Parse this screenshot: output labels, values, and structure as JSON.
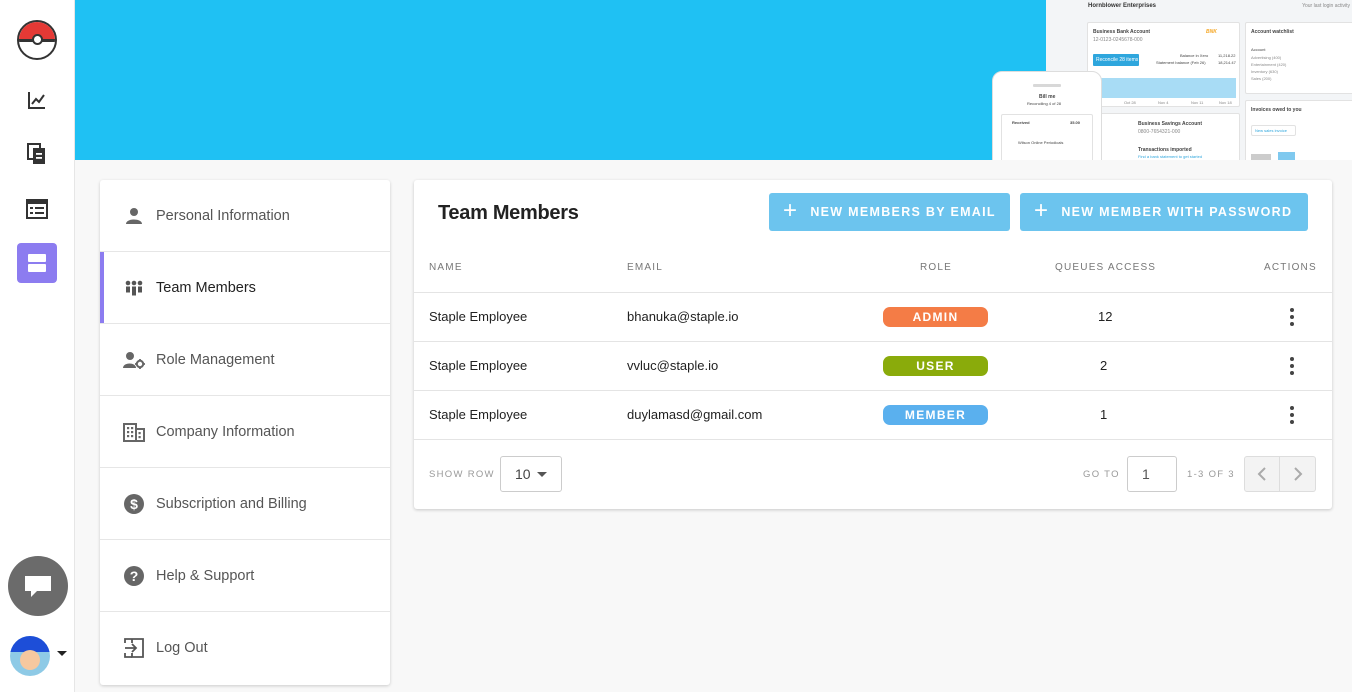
{
  "colors": {
    "accent": "#8c7cf0",
    "hero": "#1fc1f3",
    "button": "#6cc4ee",
    "role_admin": "#f47c46",
    "role_user": "#8aab0b",
    "role_member": "#5ab0ee"
  },
  "rail": {
    "items": [
      {
        "icon": "chart-line-icon"
      },
      {
        "icon": "documents-icon"
      },
      {
        "icon": "list-view-icon"
      },
      {
        "icon": "storage-icon",
        "active": true
      }
    ]
  },
  "hero_mock": {
    "company": "Hornblower Enterprises",
    "corner_text": "Your last login activity",
    "bank_account": "Business Bank Account",
    "bank_number": "12-0123-0245678-000",
    "bank_logo": "BNK",
    "reconcile": "Reconcile 28 items",
    "balance_label": "Balance in Xero",
    "balance_value": "11,218.22",
    "statement_label": "Statement balance (Feb 26)",
    "statement_value": "18,214.47",
    "dates": [
      "Oct 28",
      "Nov 4",
      "Nov 11",
      "Nov 18"
    ],
    "watchlist": "Account watchlist",
    "watch_header": "Account",
    "watch_items": [
      "Advertising (400)",
      "Entertainment (420)",
      "Inventory (630)",
      "Sales (200)"
    ],
    "savings": "Business Savings Account",
    "savings_number": "0800-7654321-000",
    "transactions": "Transactions imported",
    "transactions_sub": "Find a bank statement to get started",
    "invoices": "Invoices owed to you",
    "new_invoice": "New sales invoice",
    "phone_title": "Bill me",
    "phone_sub": "Reconciling 4 of 28",
    "phone_received": "Received",
    "phone_amount": "35.00",
    "phone_desc": "Wilson Online Periodicals"
  },
  "menu": {
    "items": [
      {
        "label": "Personal Information",
        "icon": "person-icon"
      },
      {
        "label": "Team Members",
        "icon": "team-icon",
        "active": true
      },
      {
        "label": "Role Management",
        "icon": "user-gear-icon"
      },
      {
        "label": "Company Information",
        "icon": "building-icon"
      },
      {
        "label": "Subscription and Billing",
        "icon": "dollar-circle-icon"
      },
      {
        "label": "Help & Support",
        "icon": "help-circle-icon"
      },
      {
        "label": "Log Out",
        "icon": "logout-icon"
      }
    ]
  },
  "team": {
    "title": "Team Members",
    "btn_email": "NEW MEMBERS BY EMAIL",
    "btn_password": "NEW MEMBER WITH PASSWORD",
    "columns": {
      "name": "NAME",
      "email": "EMAIL",
      "role": "ROLE",
      "queues": "QUEUES ACCESS",
      "actions": "ACTIONS"
    },
    "rows": [
      {
        "name": "Staple Employee",
        "email": "bhanuka@staple.io",
        "role": "ADMIN",
        "queues": "12"
      },
      {
        "name": "Staple Employee",
        "email": "vvluc@staple.io",
        "role": "USER",
        "queues": "2"
      },
      {
        "name": "Staple Employee",
        "email": "duylamasd@gmail.com",
        "role": "MEMBER",
        "queues": "1"
      }
    ],
    "footer": {
      "show_row_label": "SHOW ROW",
      "show_row_value": "10",
      "goto_label": "GO TO",
      "goto_value": "1",
      "range": "1-3 OF 3"
    }
  }
}
